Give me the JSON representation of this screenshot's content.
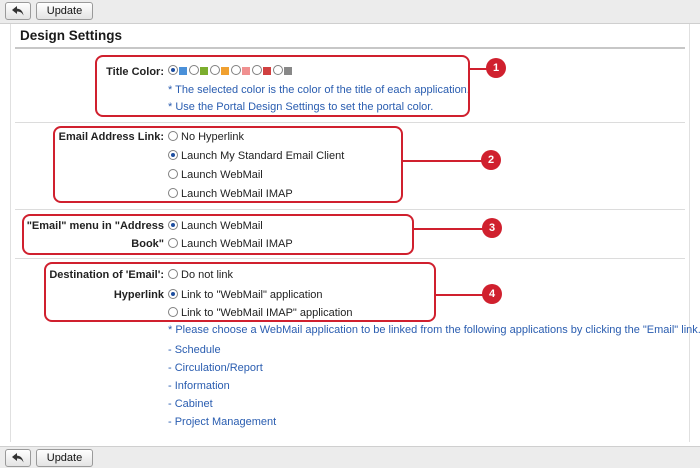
{
  "toolbar": {
    "update_label": "Update",
    "back_icon": "back-arrow-icon"
  },
  "page_title": "Design Settings",
  "title_color": {
    "label": "Title Color:",
    "swatches": [
      "#4a90d9",
      "#ffffff",
      "#7cae2e",
      "#ffffff",
      "#f0a030",
      "#ffffff",
      "#f09090",
      "#ffffff",
      "#d04040",
      "#ffffff",
      "#888888"
    ],
    "notes": [
      "* The selected color is the color of the title of each application.",
      "* Use the Portal Design Settings to set the portal color."
    ]
  },
  "email_link": {
    "label": "Email Address Link:",
    "options": [
      "No Hyperlink",
      "Launch My Standard Email Client",
      "Launch WebMail",
      "Launch WebMail IMAP"
    ],
    "selected": 1
  },
  "email_menu": {
    "label_line1": "\"Email\" menu in \"Address",
    "label_line2": "Book\"",
    "options": [
      "Launch WebMail",
      "Launch WebMail IMAP"
    ],
    "selected": 0
  },
  "email_destination": {
    "label_line1": "Destination of 'Email':",
    "label_line2": "Hyperlink",
    "options": [
      "Do not link",
      "Link to \"WebMail\" application",
      "Link to \"WebMail IMAP\" application"
    ],
    "selected": 1,
    "note": "* Please choose a WebMail application to be linked from the following applications by clicking the \"Email\" link.",
    "apps": [
      "- Schedule",
      "- Circulation/Report",
      "- Information",
      "- Cabinet",
      "- Project Management"
    ]
  },
  "callouts": [
    "1",
    "2",
    "3",
    "4"
  ],
  "colors": {
    "callout": "#d0202e",
    "link": "#2a5db0"
  }
}
